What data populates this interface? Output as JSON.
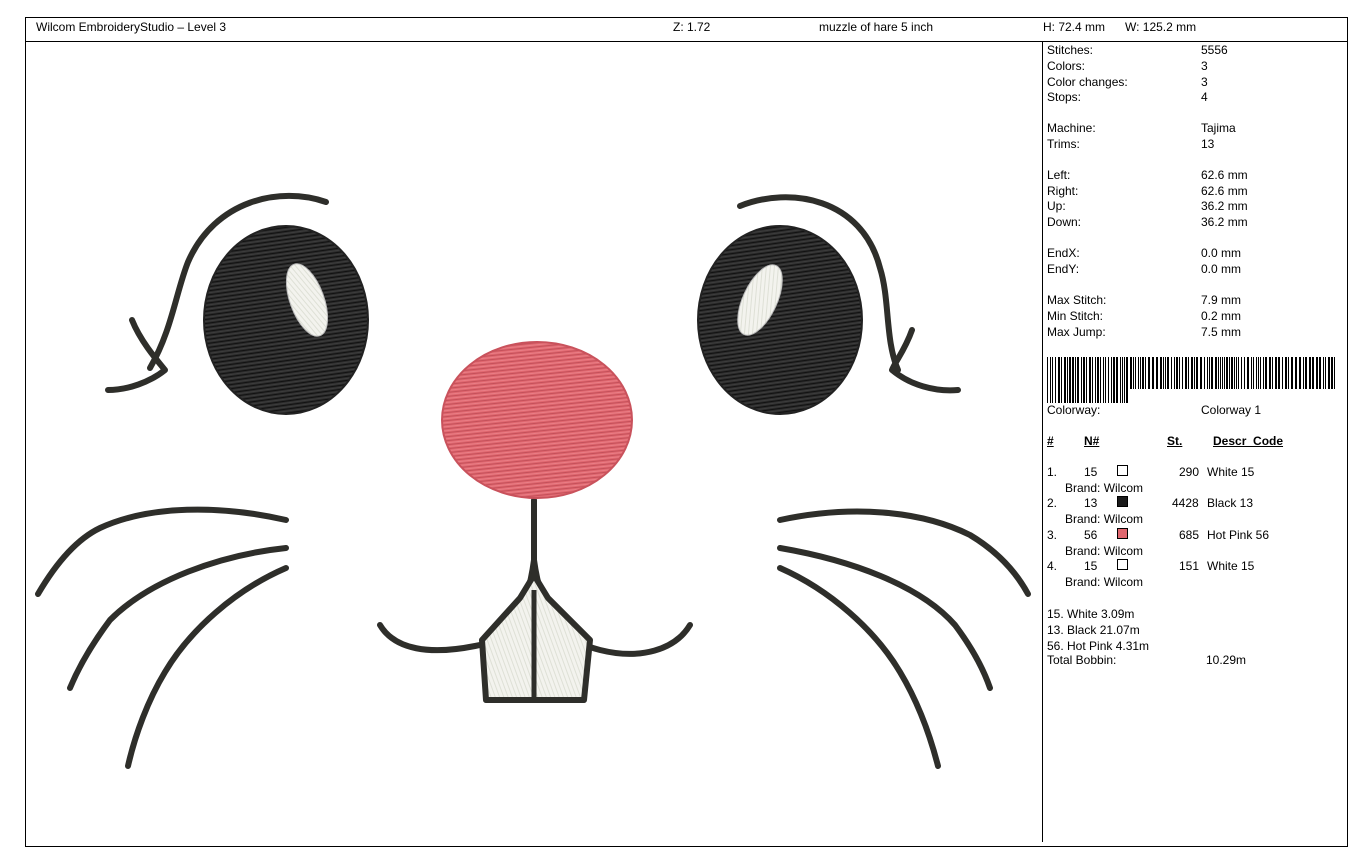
{
  "header": {
    "app_title": "Wilcom EmbroideryStudio – Level 3",
    "zoom": "Z: 1.72",
    "design_name": "muzzle of hare 5 inch",
    "height": "H: 72.4 mm",
    "width": "W: 125.2 mm"
  },
  "stats": [
    {
      "label": "Stitches:",
      "value": "5556"
    },
    {
      "label": "Colors:",
      "value": "3"
    },
    {
      "label": "Color changes:",
      "value": "3"
    },
    {
      "label": "Stops:",
      "value": "4"
    },
    {
      "label": "Machine:",
      "value": "Tajima"
    },
    {
      "label": "Trims:",
      "value": "13"
    },
    {
      "label": "Left:",
      "value": "62.6 mm"
    },
    {
      "label": "Right:",
      "value": "62.6 mm"
    },
    {
      "label": "Up:",
      "value": "36.2 mm"
    },
    {
      "label": "Down:",
      "value": "36.2 mm"
    },
    {
      "label": "EndX:",
      "value": "0.0 mm"
    },
    {
      "label": "EndY:",
      "value": "0.0 mm"
    },
    {
      "label": "Max Stitch:",
      "value": "7.9 mm"
    },
    {
      "label": "Min Stitch:",
      "value": "0.2 mm"
    },
    {
      "label": "Max Jump:",
      "value": "7.5 mm"
    }
  ],
  "colorway": {
    "label": "Colorway:",
    "value": "Colorway 1"
  },
  "table": {
    "headers": {
      "num": "#",
      "n": "N#",
      "st": "St.",
      "descr": "Descr_Code"
    },
    "rows": [
      {
        "num": "1.",
        "n": "15",
        "color": "#ffffff",
        "st": "290",
        "descr": "White 15",
        "brand": "Brand: Wilcom"
      },
      {
        "num": "2.",
        "n": "13",
        "color": "#1a1a1a",
        "st": "4428",
        "descr": "Black 13",
        "brand": "Brand: Wilcom"
      },
      {
        "num": "3.",
        "n": "56",
        "color": "#e0676f",
        "st": "685",
        "descr": "Hot Pink 56",
        "brand": "Brand: Wilcom"
      },
      {
        "num": "4.",
        "n": "15",
        "color": "#ffffff",
        "st": "151",
        "descr": "White 15",
        "brand": "Brand: Wilcom"
      }
    ]
  },
  "thread_usage": [
    "15. White  3.09m",
    "13. Black 21.07m",
    "56. Hot Pink  4.31m"
  ],
  "bobbin": {
    "label": "Total Bobbin:",
    "value": "10.29m"
  },
  "colors": {
    "black": "#2b2b2b",
    "pink": "#e0676f",
    "white": "#f0f0ea"
  }
}
